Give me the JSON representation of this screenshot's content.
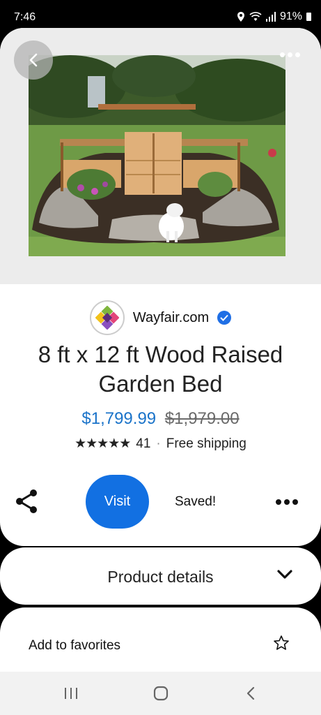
{
  "status_bar": {
    "time": "7:46",
    "battery": "91%"
  },
  "hero": {
    "image_description": "wooden raised garden bed with dog",
    "back_icon": "chevron-left-icon",
    "more_icon": "more-horizontal-icon"
  },
  "merchant": {
    "name": "Wayfair.com",
    "verified_icon": "verified-check-icon"
  },
  "product": {
    "title": "8 ft x 12 ft Wood Raised Garden Bed",
    "price": "$1,799.99",
    "old_price": "$1,979.00",
    "stars": "★★★★★",
    "review_count": "41",
    "separator": "·",
    "shipping": "Free shipping"
  },
  "actions": {
    "visit_label": "Visit",
    "saved_label": "Saved!"
  },
  "details": {
    "label": "Product details"
  },
  "favorites": {
    "label": "Add to favorites"
  },
  "colors": {
    "accent": "#1270e2",
    "price": "#1a73c9",
    "verified": "#1f6fe5"
  }
}
